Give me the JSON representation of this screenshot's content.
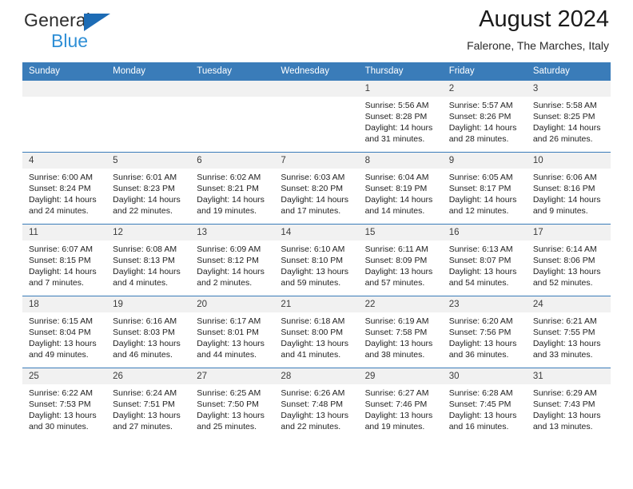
{
  "brand": {
    "name_top": "General",
    "name_bottom": "Blue",
    "triangle_color": "#1d6cb5",
    "blue_color": "#2f8fd6"
  },
  "header": {
    "title": "August 2024",
    "subtitle": "Falerone, The Marches, Italy"
  },
  "theme": {
    "header_row_bg": "#3a7cb9",
    "header_row_text": "#ffffff",
    "daynum_bg": "#f1f1f1",
    "row_border": "#3a7cb9"
  },
  "weekdays": [
    "Sunday",
    "Monday",
    "Tuesday",
    "Wednesday",
    "Thursday",
    "Friday",
    "Saturday"
  ],
  "weeks": [
    [
      {
        "empty": true
      },
      {
        "empty": true
      },
      {
        "empty": true
      },
      {
        "empty": true
      },
      {
        "day": "1",
        "sunrise": "Sunrise: 5:56 AM",
        "sunset": "Sunset: 8:28 PM",
        "daylight1": "Daylight: 14 hours",
        "daylight2": "and 31 minutes."
      },
      {
        "day": "2",
        "sunrise": "Sunrise: 5:57 AM",
        "sunset": "Sunset: 8:26 PM",
        "daylight1": "Daylight: 14 hours",
        "daylight2": "and 28 minutes."
      },
      {
        "day": "3",
        "sunrise": "Sunrise: 5:58 AM",
        "sunset": "Sunset: 8:25 PM",
        "daylight1": "Daylight: 14 hours",
        "daylight2": "and 26 minutes."
      }
    ],
    [
      {
        "day": "4",
        "sunrise": "Sunrise: 6:00 AM",
        "sunset": "Sunset: 8:24 PM",
        "daylight1": "Daylight: 14 hours",
        "daylight2": "and 24 minutes."
      },
      {
        "day": "5",
        "sunrise": "Sunrise: 6:01 AM",
        "sunset": "Sunset: 8:23 PM",
        "daylight1": "Daylight: 14 hours",
        "daylight2": "and 22 minutes."
      },
      {
        "day": "6",
        "sunrise": "Sunrise: 6:02 AM",
        "sunset": "Sunset: 8:21 PM",
        "daylight1": "Daylight: 14 hours",
        "daylight2": "and 19 minutes."
      },
      {
        "day": "7",
        "sunrise": "Sunrise: 6:03 AM",
        "sunset": "Sunset: 8:20 PM",
        "daylight1": "Daylight: 14 hours",
        "daylight2": "and 17 minutes."
      },
      {
        "day": "8",
        "sunrise": "Sunrise: 6:04 AM",
        "sunset": "Sunset: 8:19 PM",
        "daylight1": "Daylight: 14 hours",
        "daylight2": "and 14 minutes."
      },
      {
        "day": "9",
        "sunrise": "Sunrise: 6:05 AM",
        "sunset": "Sunset: 8:17 PM",
        "daylight1": "Daylight: 14 hours",
        "daylight2": "and 12 minutes."
      },
      {
        "day": "10",
        "sunrise": "Sunrise: 6:06 AM",
        "sunset": "Sunset: 8:16 PM",
        "daylight1": "Daylight: 14 hours",
        "daylight2": "and 9 minutes."
      }
    ],
    [
      {
        "day": "11",
        "sunrise": "Sunrise: 6:07 AM",
        "sunset": "Sunset: 8:15 PM",
        "daylight1": "Daylight: 14 hours",
        "daylight2": "and 7 minutes."
      },
      {
        "day": "12",
        "sunrise": "Sunrise: 6:08 AM",
        "sunset": "Sunset: 8:13 PM",
        "daylight1": "Daylight: 14 hours",
        "daylight2": "and 4 minutes."
      },
      {
        "day": "13",
        "sunrise": "Sunrise: 6:09 AM",
        "sunset": "Sunset: 8:12 PM",
        "daylight1": "Daylight: 14 hours",
        "daylight2": "and 2 minutes."
      },
      {
        "day": "14",
        "sunrise": "Sunrise: 6:10 AM",
        "sunset": "Sunset: 8:10 PM",
        "daylight1": "Daylight: 13 hours",
        "daylight2": "and 59 minutes."
      },
      {
        "day": "15",
        "sunrise": "Sunrise: 6:11 AM",
        "sunset": "Sunset: 8:09 PM",
        "daylight1": "Daylight: 13 hours",
        "daylight2": "and 57 minutes."
      },
      {
        "day": "16",
        "sunrise": "Sunrise: 6:13 AM",
        "sunset": "Sunset: 8:07 PM",
        "daylight1": "Daylight: 13 hours",
        "daylight2": "and 54 minutes."
      },
      {
        "day": "17",
        "sunrise": "Sunrise: 6:14 AM",
        "sunset": "Sunset: 8:06 PM",
        "daylight1": "Daylight: 13 hours",
        "daylight2": "and 52 minutes."
      }
    ],
    [
      {
        "day": "18",
        "sunrise": "Sunrise: 6:15 AM",
        "sunset": "Sunset: 8:04 PM",
        "daylight1": "Daylight: 13 hours",
        "daylight2": "and 49 minutes."
      },
      {
        "day": "19",
        "sunrise": "Sunrise: 6:16 AM",
        "sunset": "Sunset: 8:03 PM",
        "daylight1": "Daylight: 13 hours",
        "daylight2": "and 46 minutes."
      },
      {
        "day": "20",
        "sunrise": "Sunrise: 6:17 AM",
        "sunset": "Sunset: 8:01 PM",
        "daylight1": "Daylight: 13 hours",
        "daylight2": "and 44 minutes."
      },
      {
        "day": "21",
        "sunrise": "Sunrise: 6:18 AM",
        "sunset": "Sunset: 8:00 PM",
        "daylight1": "Daylight: 13 hours",
        "daylight2": "and 41 minutes."
      },
      {
        "day": "22",
        "sunrise": "Sunrise: 6:19 AM",
        "sunset": "Sunset: 7:58 PM",
        "daylight1": "Daylight: 13 hours",
        "daylight2": "and 38 minutes."
      },
      {
        "day": "23",
        "sunrise": "Sunrise: 6:20 AM",
        "sunset": "Sunset: 7:56 PM",
        "daylight1": "Daylight: 13 hours",
        "daylight2": "and 36 minutes."
      },
      {
        "day": "24",
        "sunrise": "Sunrise: 6:21 AM",
        "sunset": "Sunset: 7:55 PM",
        "daylight1": "Daylight: 13 hours",
        "daylight2": "and 33 minutes."
      }
    ],
    [
      {
        "day": "25",
        "sunrise": "Sunrise: 6:22 AM",
        "sunset": "Sunset: 7:53 PM",
        "daylight1": "Daylight: 13 hours",
        "daylight2": "and 30 minutes."
      },
      {
        "day": "26",
        "sunrise": "Sunrise: 6:24 AM",
        "sunset": "Sunset: 7:51 PM",
        "daylight1": "Daylight: 13 hours",
        "daylight2": "and 27 minutes."
      },
      {
        "day": "27",
        "sunrise": "Sunrise: 6:25 AM",
        "sunset": "Sunset: 7:50 PM",
        "daylight1": "Daylight: 13 hours",
        "daylight2": "and 25 minutes."
      },
      {
        "day": "28",
        "sunrise": "Sunrise: 6:26 AM",
        "sunset": "Sunset: 7:48 PM",
        "daylight1": "Daylight: 13 hours",
        "daylight2": "and 22 minutes."
      },
      {
        "day": "29",
        "sunrise": "Sunrise: 6:27 AM",
        "sunset": "Sunset: 7:46 PM",
        "daylight1": "Daylight: 13 hours",
        "daylight2": "and 19 minutes."
      },
      {
        "day": "30",
        "sunrise": "Sunrise: 6:28 AM",
        "sunset": "Sunset: 7:45 PM",
        "daylight1": "Daylight: 13 hours",
        "daylight2": "and 16 minutes."
      },
      {
        "day": "31",
        "sunrise": "Sunrise: 6:29 AM",
        "sunset": "Sunset: 7:43 PM",
        "daylight1": "Daylight: 13 hours",
        "daylight2": "and 13 minutes."
      }
    ]
  ]
}
